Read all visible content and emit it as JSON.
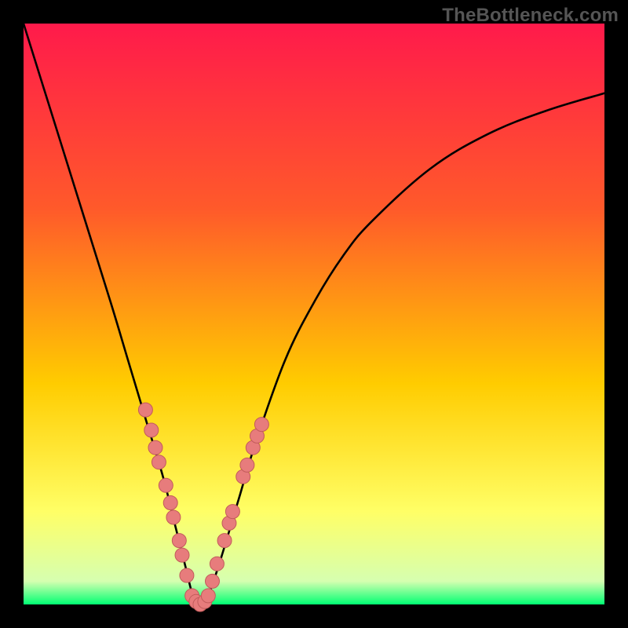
{
  "watermark": "TheBottleneck.com",
  "colors": {
    "frame": "#000000",
    "gradient_top": "#ff1a4b",
    "gradient_upper_mid": "#ff5a2a",
    "gradient_mid": "#ffcc00",
    "gradient_lower_mid": "#ffff66",
    "gradient_bottom": "#00ff73",
    "curve": "#000000",
    "dot_fill": "#e77c7c",
    "dot_stroke": "#c25b5b"
  },
  "chart_data": {
    "type": "line",
    "title": "",
    "xlabel": "",
    "ylabel": "",
    "xlim": [
      0,
      100
    ],
    "ylim": [
      0,
      100
    ],
    "legend": false,
    "grid": false,
    "axes_visible": false,
    "annotations": [
      "Gradient background red→yellow→green (top→bottom); black frame border"
    ],
    "series": [
      {
        "name": "curve",
        "x": [
          0,
          5,
          10,
          15,
          18,
          21,
          24,
          26,
          28,
          29,
          30,
          31,
          32,
          34,
          37,
          40,
          45,
          50,
          55,
          60,
          70,
          80,
          90,
          100
        ],
        "y": [
          100,
          84,
          68,
          52,
          42,
          32,
          22,
          14,
          6,
          2,
          0,
          0,
          2,
          8,
          18,
          28,
          42,
          52,
          60,
          66,
          75,
          81,
          85,
          88
        ]
      }
    ],
    "dots": {
      "name": "highlighted-points",
      "points": [
        {
          "x": 21.0,
          "y": 33.5
        },
        {
          "x": 22.0,
          "y": 30.0
        },
        {
          "x": 22.7,
          "y": 27.0
        },
        {
          "x": 23.3,
          "y": 24.5
        },
        {
          "x": 24.5,
          "y": 20.5
        },
        {
          "x": 25.3,
          "y": 17.5
        },
        {
          "x": 25.8,
          "y": 15.0
        },
        {
          "x": 26.8,
          "y": 11.0
        },
        {
          "x": 27.3,
          "y": 8.5
        },
        {
          "x": 28.1,
          "y": 5.0
        },
        {
          "x": 29.0,
          "y": 1.5
        },
        {
          "x": 29.7,
          "y": 0.5
        },
        {
          "x": 30.4,
          "y": 0.0
        },
        {
          "x": 31.2,
          "y": 0.5
        },
        {
          "x": 31.8,
          "y": 1.5
        },
        {
          "x": 32.5,
          "y": 4.0
        },
        {
          "x": 33.3,
          "y": 7.0
        },
        {
          "x": 34.6,
          "y": 11.0
        },
        {
          "x": 35.4,
          "y": 14.0
        },
        {
          "x": 36.0,
          "y": 16.0
        },
        {
          "x": 37.8,
          "y": 22.0
        },
        {
          "x": 38.5,
          "y": 24.0
        },
        {
          "x": 39.5,
          "y": 27.0
        },
        {
          "x": 40.2,
          "y": 29.0
        },
        {
          "x": 41.0,
          "y": 31.0
        }
      ]
    }
  }
}
